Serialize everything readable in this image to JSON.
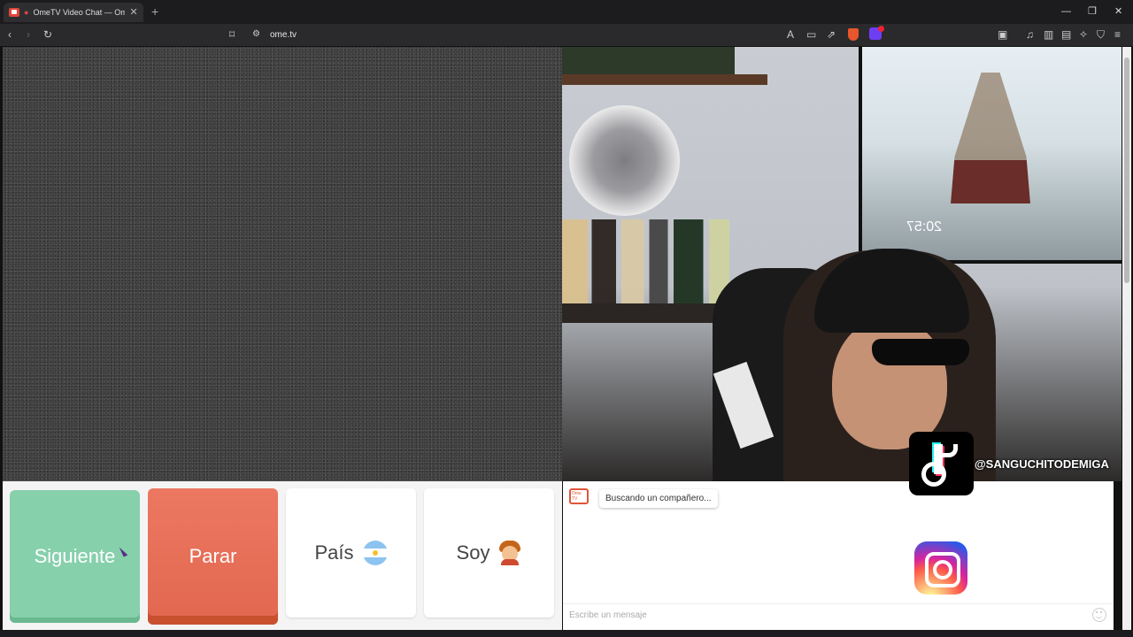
{
  "browser": {
    "tab_title": "OmeTV Video Chat — Omeg",
    "tab_close": "✕",
    "new_tab": "+",
    "url": "ome.tv",
    "window_controls": [
      "—",
      "❐",
      "✕"
    ]
  },
  "video": {
    "remote_state": "static-noise",
    "clock_text": "20:57"
  },
  "controls": {
    "next_label": "Siguiente",
    "stop_label": "Parar",
    "country_label": "País",
    "gender_label": "Soy"
  },
  "chat": {
    "status_message": "Buscando un compañero...",
    "input_placeholder": "Escribe un mensaje"
  },
  "overlays": {
    "tiktok_handle": "@SANGUCHITODEMIGA"
  },
  "colors": {
    "next_button": "#86d0ab",
    "stop_button": "#e2674f",
    "brand": "#e2553a"
  }
}
